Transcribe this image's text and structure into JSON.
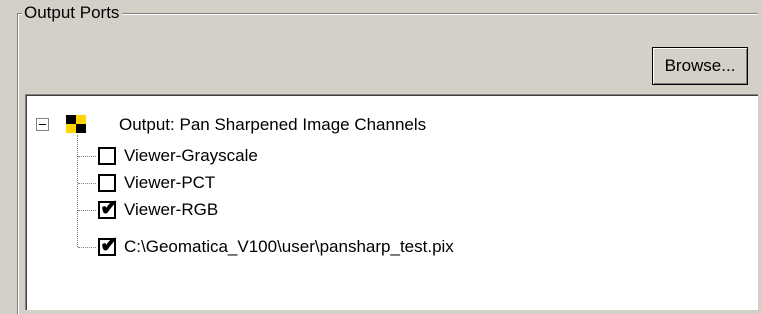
{
  "group": {
    "title": "Output Ports"
  },
  "toolbar": {
    "browse_label": "Browse..."
  },
  "tree": {
    "root": {
      "label": "Output: Pan Sharpened Image Channels",
      "expanded": true,
      "icon": "output-port-icon"
    },
    "items": [
      {
        "label": "Viewer-Grayscale",
        "checked": false
      },
      {
        "label": "Viewer-PCT",
        "checked": false
      },
      {
        "label": "Viewer-RGB",
        "checked": true
      },
      {
        "label": "C:\\Geomatica_V100\\user\\pansharp_test.pix",
        "checked": true
      }
    ]
  },
  "colors": {
    "panel_bg": "#d4d0c8",
    "tree_bg": "#ffffff",
    "icon_yellow": "#ffd400"
  }
}
